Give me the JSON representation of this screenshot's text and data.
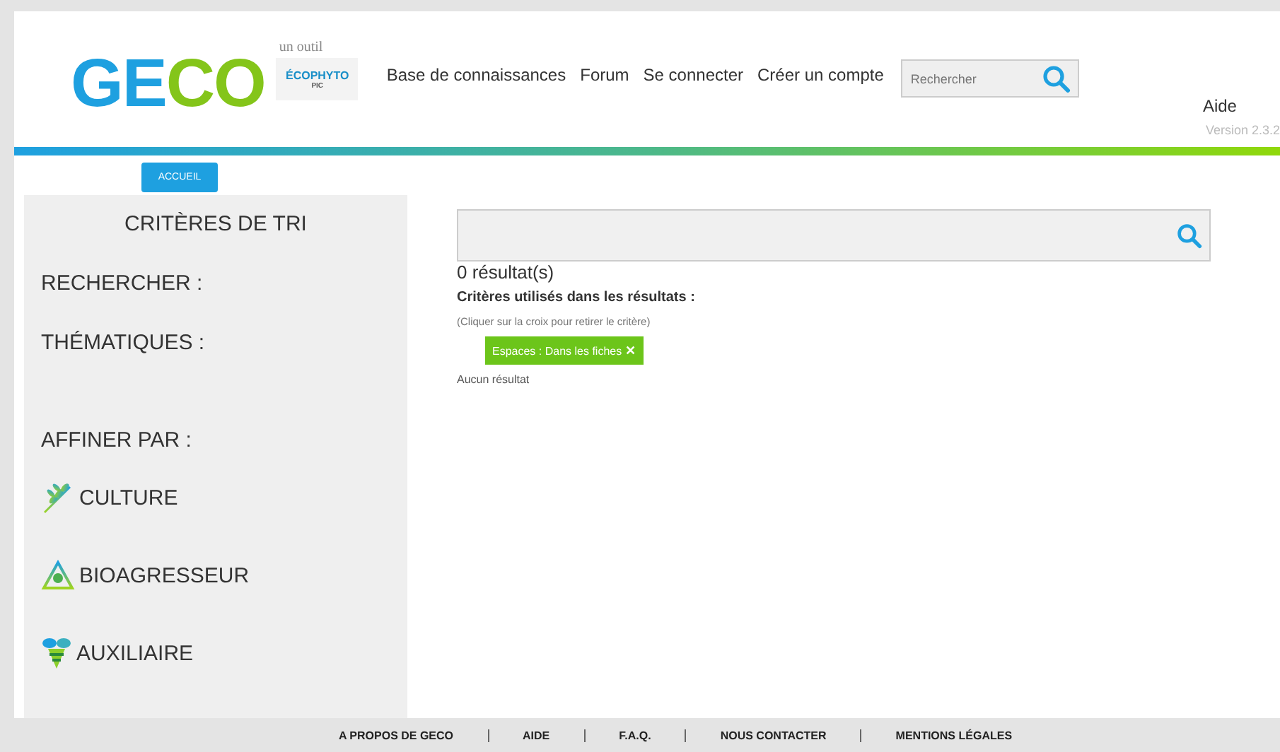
{
  "header": {
    "logo_letters": [
      {
        "text": "GE",
        "color": "#1ea0e0"
      },
      {
        "text": "CO",
        "color": "#84c51a"
      }
    ],
    "tagline": "un outil",
    "partner_logo": {
      "name": "ÉCOPHYTO",
      "sub": "PIC"
    },
    "nav": [
      "Base de connaissances",
      "Forum",
      "Se connecter",
      "Créer un compte"
    ],
    "search": {
      "placeholder": "Rechercher"
    },
    "help": "Aide",
    "version": "Version 2.3.2"
  },
  "home_button": "ACCUEIL",
  "sidebar": {
    "title": "CRITÈRES DE TRI",
    "sections": [
      {
        "label": "RECHERCHER :"
      },
      {
        "label": "THÉMATIQUES :"
      }
    ],
    "refine_label": "AFFINER PAR :",
    "filters": [
      {
        "label": "CULTURE",
        "kind": "culture"
      },
      {
        "label": "BIOAGRESSEUR",
        "kind": "pest"
      },
      {
        "label": "AUXILIAIRE",
        "kind": "auxiliary"
      }
    ]
  },
  "results": {
    "count": "0 résultat(s)",
    "criteria_title": "Critères utilisés dans les résultats :",
    "hint": "(Cliquer sur la croix pour retirer le critère)",
    "criteria": [
      {
        "label": "Espaces : Dans les fiches",
        "remove": "✕"
      }
    ],
    "empty": "Aucun résultat"
  },
  "footer": [
    "A PROPOS DE GECO",
    "AIDE",
    "F.A.Q.",
    "NOUS CONTACTER",
    "MENTIONS LÉGALES"
  ]
}
